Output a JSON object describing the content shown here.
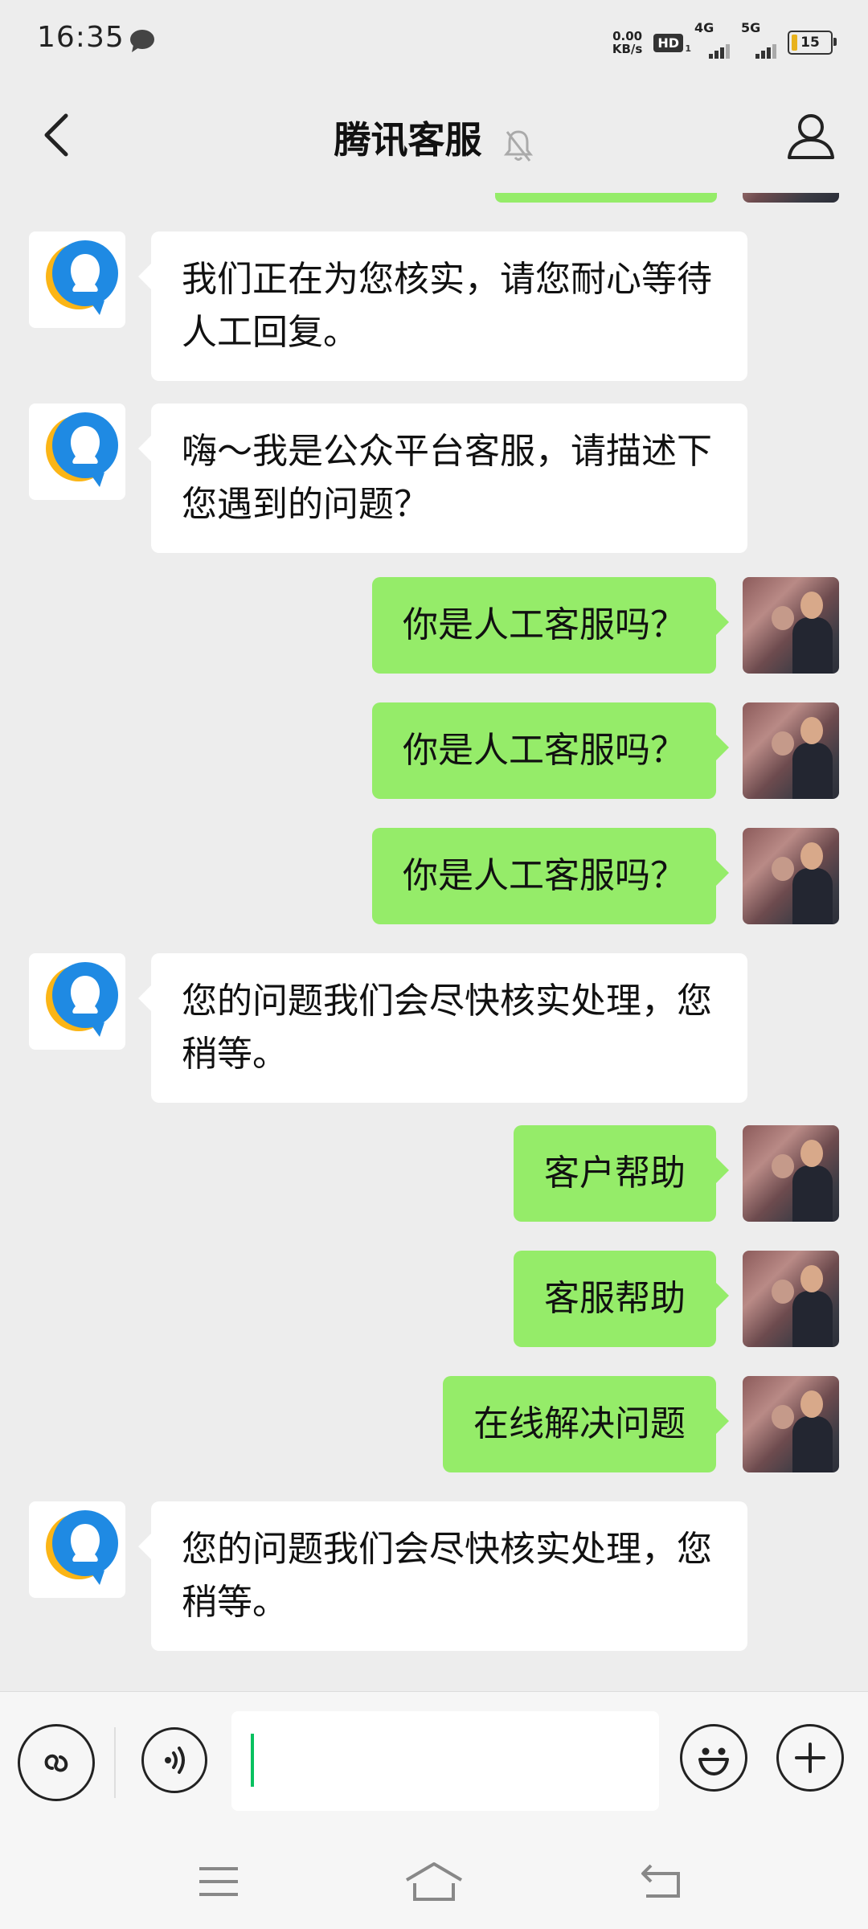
{
  "status_bar": {
    "time": "16:35",
    "net_speed_value": "0.00",
    "net_speed_unit": "KB/s",
    "hd_label": "HD",
    "hd_sub": "1",
    "sig1_label": "4G",
    "sig2_label": "5G",
    "battery": "15"
  },
  "header": {
    "title": "腾讯客服"
  },
  "chat": {
    "messages": [
      {
        "side": "left",
        "text": "我们正在为您核实，请您耐心等待人工回复。"
      },
      {
        "side": "left",
        "text": "嗨～我是公众平台客服，请描述下您遇到的问题？"
      },
      {
        "side": "right",
        "text": "你是人工客服吗？"
      },
      {
        "side": "right",
        "text": "你是人工客服吗？"
      },
      {
        "side": "right",
        "text": "你是人工客服吗？"
      },
      {
        "side": "left",
        "text": "您的问题我们会尽快核实处理，您稍等。"
      },
      {
        "side": "right",
        "text": "客户帮助"
      },
      {
        "side": "right",
        "text": "客服帮助"
      },
      {
        "side": "right",
        "text": "在线解决问题"
      },
      {
        "side": "left",
        "text": "您的问题我们会尽快核实处理，您稍等。"
      }
    ]
  },
  "input_bar": {
    "text_value": ""
  },
  "colors": {
    "background": "#ededed",
    "sent_bubble": "#95ec69",
    "received_bubble": "#ffffff",
    "caret": "#07c160"
  },
  "icons": {
    "back": "chevron-left-icon",
    "mute": "bell-off-icon",
    "profile": "person-icon",
    "mini_program": "link-icon",
    "voice": "voice-icon",
    "emoji": "smile-icon",
    "more": "plus-icon"
  }
}
